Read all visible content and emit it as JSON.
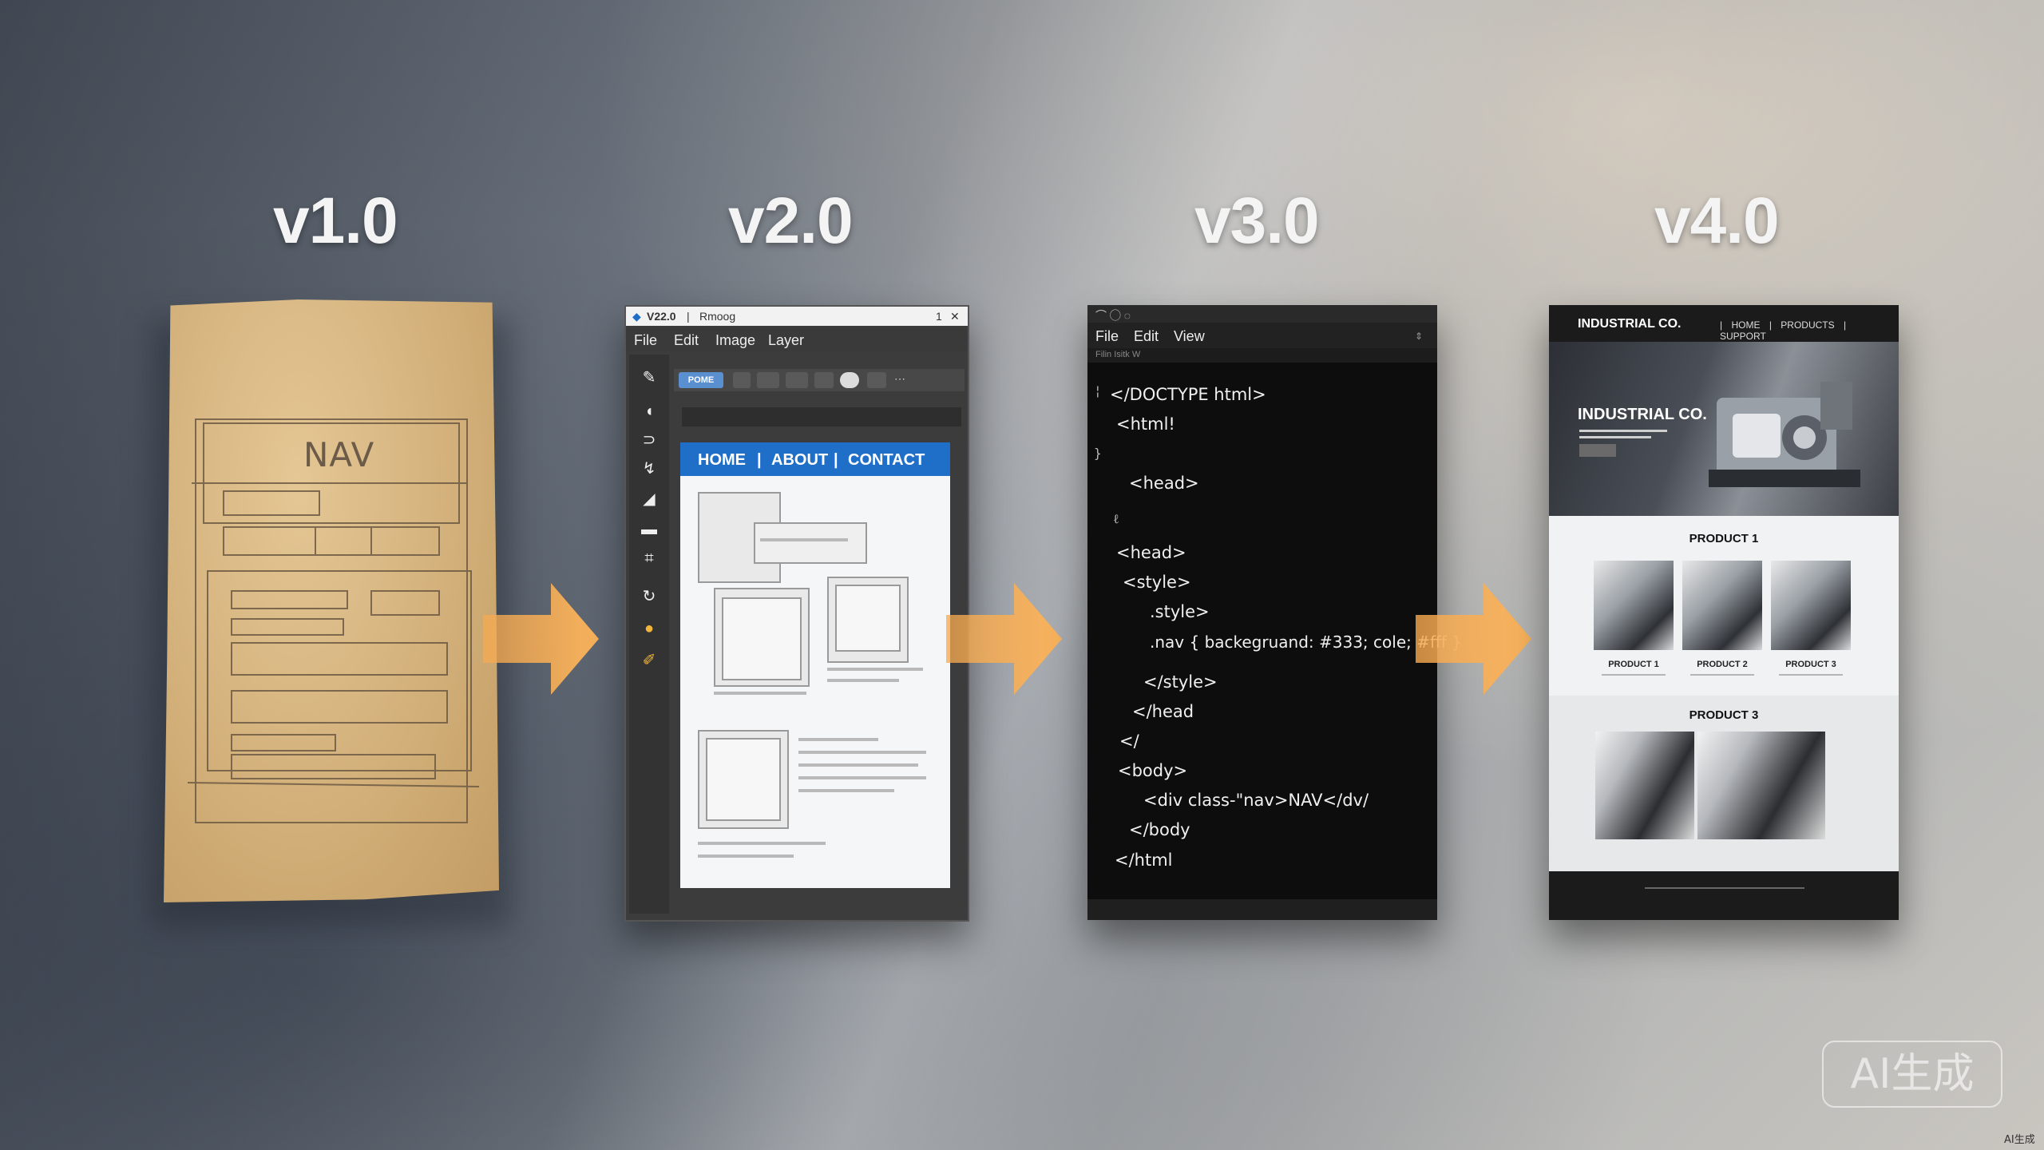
{
  "stages": [
    {
      "version": "v1.0"
    },
    {
      "version": "v2.0"
    },
    {
      "version": "v3.0"
    },
    {
      "version": "v4.0"
    }
  ],
  "sketch": {
    "nav_text": "NAV"
  },
  "editor": {
    "title": "V22.0",
    "title_name": "Rmoog",
    "title_controls": [
      "1",
      "✕"
    ],
    "menu": [
      "File",
      "Edit",
      "Image",
      "Layer"
    ],
    "option_button": "POME",
    "nav_items": [
      "HOME",
      "ABOUT",
      "CONTACT"
    ],
    "nav_separator": "|"
  },
  "code": {
    "menu": [
      "File",
      "Edit",
      "View"
    ],
    "sub_menu": "Filin  Isitk  W",
    "lines": [
      "</DOCTYPE html>",
      "<html!",
      "<head>",
      "<head>",
      "<style>",
      ".style>",
      ".nav { backegruand: #333; cole; #fff }",
      "</style>",
      "</head",
      "</",
      "<body>",
      "<div class-\"nav>NAV</dv/",
      "</body",
      "</html"
    ]
  },
  "site": {
    "logo": "INDUSTRIAL CO.",
    "nav": [
      "HOME",
      "PRODUCTS",
      "SUPPORT"
    ],
    "nav_separator": "|",
    "hero_title": "INDUSTRIAL CO.",
    "section1_title": "PRODUCT 1",
    "products": [
      {
        "label": "PRODUCT 1"
      },
      {
        "label": "PRODUCT 2"
      },
      {
        "label": "PRODUCT 3"
      }
    ],
    "section2_title": "PRODUCT 3"
  },
  "watermark": "AI生成",
  "corner_mark": "AI生成",
  "colors": {
    "arrow": "#f6a94f",
    "editor_nav": "#1f6fc8",
    "paper": "#d6b47e",
    "code_bg": "#0d0d0d"
  }
}
